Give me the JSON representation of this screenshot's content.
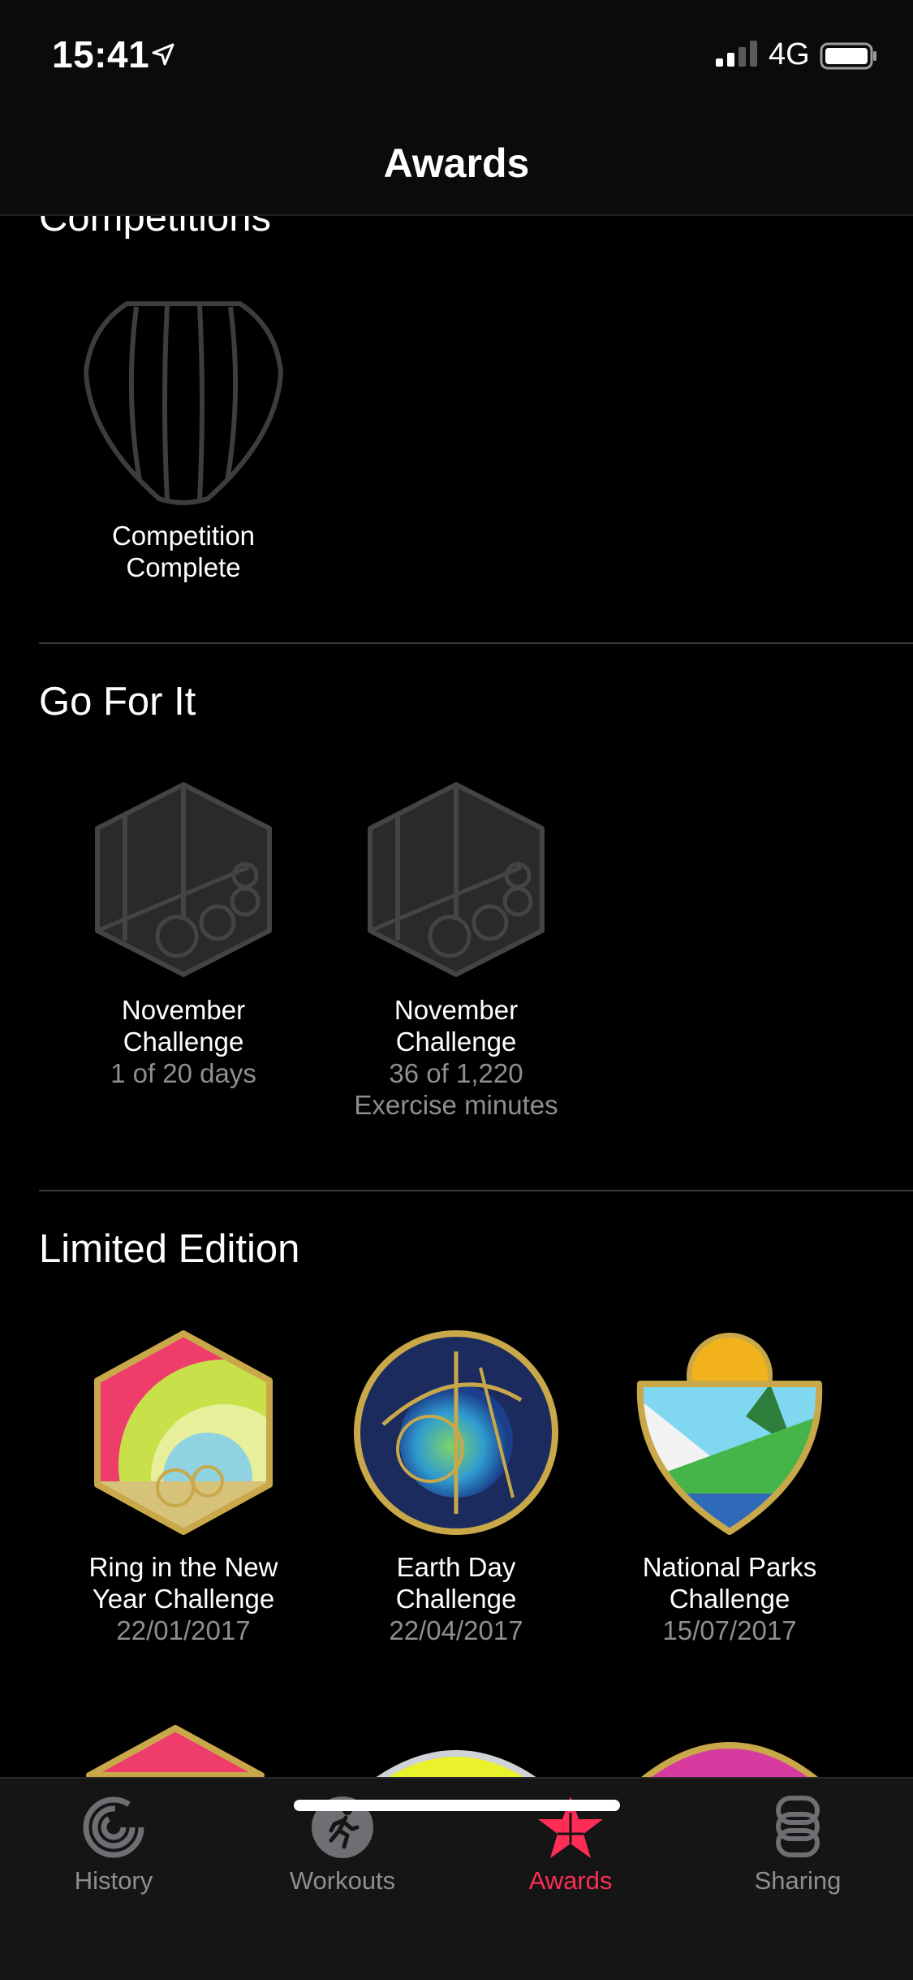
{
  "status_bar": {
    "time": "15:41",
    "network": "4G"
  },
  "nav": {
    "title": "Awards"
  },
  "sections": {
    "competitions": {
      "title": "Competitions",
      "awards": [
        {
          "name": "Competition Complete",
          "sub": ""
        }
      ]
    },
    "go_for_it": {
      "title": "Go For It",
      "awards": [
        {
          "name": "November Challenge",
          "sub": "1 of 20 days"
        },
        {
          "name": "November Challenge",
          "sub": "36 of 1,220 Exercise minutes"
        }
      ]
    },
    "limited_edition": {
      "title": "Limited Edition",
      "awards": [
        {
          "name": "Ring in the New Year Challenge",
          "sub": "22/01/2017"
        },
        {
          "name": "Earth Day Challenge",
          "sub": "22/04/2017"
        },
        {
          "name": "National Parks Challenge",
          "sub": "15/07/2017"
        }
      ]
    }
  },
  "tabs": [
    {
      "label": "History",
      "icon": "rings-icon"
    },
    {
      "label": "Workouts",
      "icon": "runner-icon"
    },
    {
      "label": "Awards",
      "icon": "star-icon"
    },
    {
      "label": "Sharing",
      "icon": "sharing-icon"
    }
  ],
  "colors": {
    "accent": "#ff2d55",
    "background": "#000000",
    "secondary_text": "#8e8e93"
  }
}
